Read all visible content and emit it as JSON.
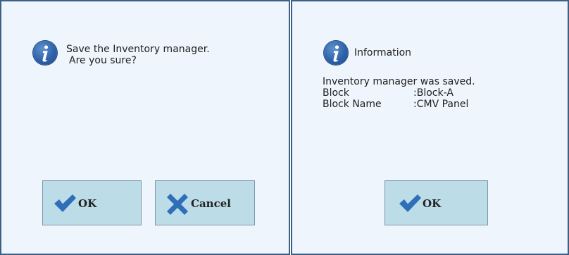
{
  "confirm_dialog": {
    "message_line1": "Save the Inventory manager.",
    "message_line2": "Are you sure?",
    "ok_label": "OK",
    "cancel_label": "Cancel"
  },
  "info_dialog": {
    "title": "Information",
    "message": "Inventory manager was saved.",
    "details": [
      {
        "label": "Block",
        "value": ":Block-A"
      },
      {
        "label": "Block Name",
        "value": ":CMV Panel"
      }
    ],
    "ok_label": "OK"
  },
  "colors": {
    "dialog_background": "#eef5fc",
    "dialog_border": "#3d5f83",
    "button_background": "#bcdce8",
    "check_icon": "#2e6fb8",
    "cross_icon": "#2e6fb8",
    "info_icon": "#2e62a8"
  },
  "icons": {
    "info": "info-icon",
    "check": "check-icon",
    "cross": "close-icon"
  }
}
